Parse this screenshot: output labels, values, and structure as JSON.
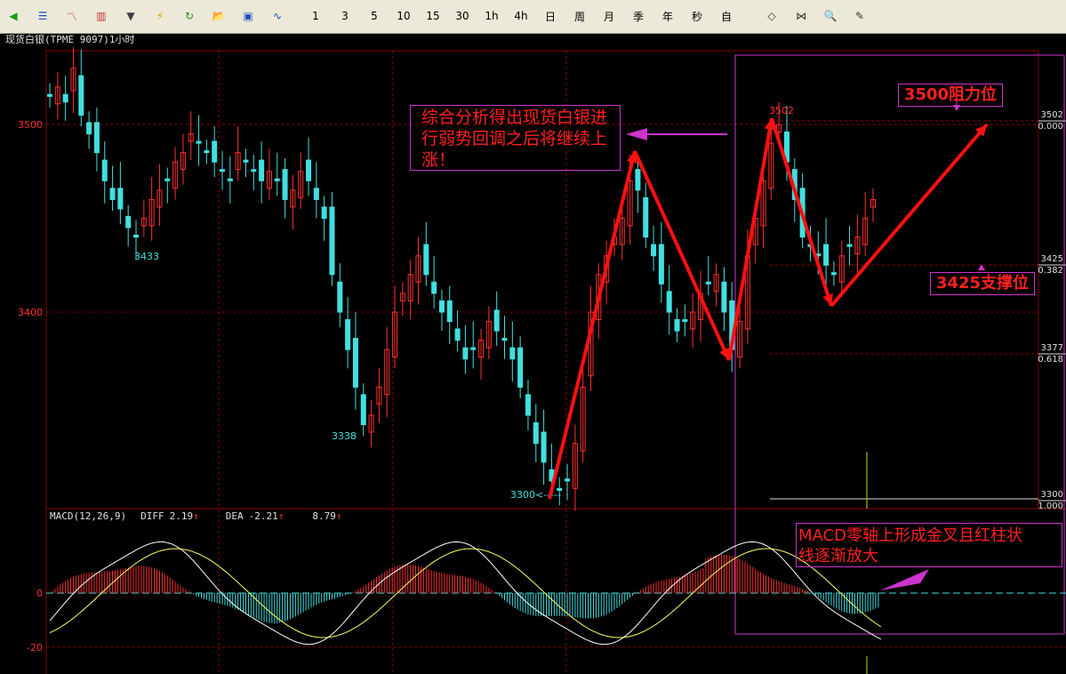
{
  "toolbar": {
    "buttons": [
      {
        "name": "back-button",
        "icon": "green-back-arrow-icon",
        "glyph": "◀",
        "color": "#1a9a1a"
      },
      {
        "name": "list-view-button",
        "icon": "list-icon",
        "glyph": "☰",
        "color": "#2050c0"
      },
      {
        "name": "line-chart-button",
        "icon": "line-chart-icon",
        "glyph": "〽",
        "color": "#c03030"
      },
      {
        "name": "candle-chart-button",
        "icon": "candlestick-icon",
        "glyph": "▥",
        "color": "#c03030"
      },
      {
        "name": "dropdown-button",
        "icon": "chevron-down-icon",
        "glyph": "▼",
        "color": "#404040"
      },
      {
        "name": "flash-button",
        "icon": "lightning-icon",
        "glyph": "⚡",
        "color": "#e0a000"
      },
      {
        "name": "refresh-button",
        "icon": "refresh-icon",
        "glyph": "↻",
        "color": "#209020"
      },
      {
        "name": "open-button",
        "icon": "folder-icon",
        "glyph": "📂",
        "color": "#d0a020"
      },
      {
        "name": "save-button",
        "icon": "save-icon",
        "glyph": "▣",
        "color": "#2050c0"
      },
      {
        "name": "indicator-button",
        "icon": "wave-icon",
        "glyph": "∿",
        "color": "#2050c0"
      }
    ],
    "periods": [
      "1",
      "3",
      "5",
      "10",
      "15",
      "30",
      "1h",
      "4h",
      "日",
      "周",
      "月",
      "季",
      "年",
      "秒",
      "自"
    ],
    "tools": [
      {
        "name": "expand-button",
        "icon": "expand-icon",
        "glyph": "◇"
      },
      {
        "name": "shrink-button",
        "icon": "shrink-icon",
        "glyph": "⋈"
      },
      {
        "name": "zoom-button",
        "icon": "magnifier-icon",
        "glyph": "🔍"
      },
      {
        "name": "draw-button",
        "icon": "pen-icon",
        "glyph": "✎"
      }
    ]
  },
  "title": "现货白银(TPME 9097)1小时",
  "price_axis": {
    "labels": [
      "3500",
      "3400"
    ]
  },
  "right_axis": [
    {
      "price": "3502",
      "ratio": "0.000"
    },
    {
      "price": "3425",
      "ratio": "0.382"
    },
    {
      "price": "3377",
      "ratio": "0.618"
    },
    {
      "price": "3300",
      "ratio": "1.000"
    }
  ],
  "price_marks": {
    "high": "3502",
    "low1": "3433",
    "low2": "3338",
    "low3": "3300<-----"
  },
  "annotations": {
    "main": "综合分析得出现货白银进行弱势回调之后将继续上涨！",
    "resistance": "3500阻力位",
    "support": "3425支撑位",
    "macd": "MACD零轴上形成金叉且红柱状\n线逐渐放大"
  },
  "macd": {
    "name": "MACD(12,26,9)",
    "diff_label": "DIFF",
    "diff_value": "2.19",
    "dea_label": "DEA",
    "dea_value": "-2.21",
    "macd_value": "8.79",
    "up_arrow": "↑",
    "axis": [
      "0",
      "-20"
    ]
  },
  "colors": {
    "up": "#ff3030",
    "down": "#40e0e0",
    "grid": "#8b0000",
    "accent": "#cc33cc",
    "arrow": "#ff1010"
  },
  "chart_data": {
    "type": "candlestick",
    "ylim": [
      3270,
      3550
    ],
    "close": [
      3515,
      3520,
      3512,
      3530,
      3505,
      3495,
      3485,
      3470,
      3460,
      3455,
      3445,
      3440,
      3450,
      3460,
      3465,
      3470,
      3480,
      3485,
      3495,
      3490,
      3485,
      3480,
      3475,
      3470,
      3485,
      3480,
      3475,
      3470,
      3475,
      3470,
      3460,
      3465,
      3475,
      3470,
      3460,
      3450,
      3420,
      3400,
      3380,
      3360,
      3340,
      3345,
      3360,
      3380,
      3400,
      3410,
      3420,
      3430,
      3420,
      3410,
      3400,
      3395,
      3385,
      3375,
      3380,
      3385,
      3395,
      3390,
      3385,
      3375,
      3360,
      3345,
      3330,
      3320,
      3310,
      3305,
      3310,
      3330,
      3360,
      3400,
      3420,
      3430,
      3440,
      3450,
      3470,
      3465,
      3440,
      3430,
      3415,
      3400,
      3390,
      3395,
      3400,
      3410,
      3415,
      3420,
      3400,
      3380,
      3395,
      3430,
      3450,
      3470,
      3490,
      3500,
      3480,
      3460,
      3440,
      3435,
      3430,
      3425,
      3420,
      3430,
      3435,
      3440,
      3450,
      3460
    ],
    "macd": {
      "axis": [
        0,
        -20
      ]
    }
  }
}
